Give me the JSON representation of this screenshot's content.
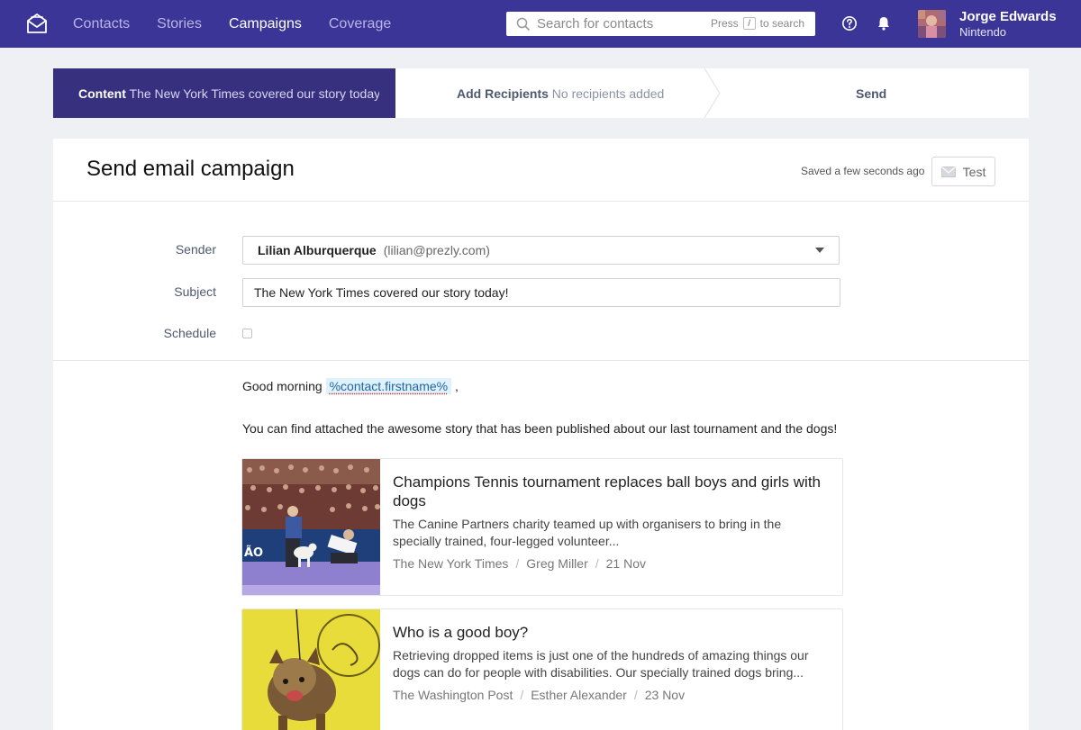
{
  "nav": {
    "links": [
      "Contacts",
      "Stories",
      "Campaigns",
      "Coverage"
    ],
    "active": "Campaigns",
    "search_placeholder": "Search for contacts",
    "search_hint_press": "Press",
    "search_hint_key": "/",
    "search_hint_rest": "to search",
    "user_name": "Jorge Edwards",
    "user_org": "Nintendo"
  },
  "stepper": {
    "step1_label": "Content",
    "step1_detail": "The New York Times covered our story today!",
    "step2_label": "Add Recipients",
    "step2_detail": "No recipients added",
    "step3_label": "Send"
  },
  "campaign": {
    "title": "Send email campaign",
    "saved_status": "Saved a few seconds ago",
    "test_label": "Test",
    "sender_label": "Sender",
    "sender_name": "Lilian Alburquerque",
    "sender_email": "(lilian@prezly.com)",
    "subject_label": "Subject",
    "subject_value": "The New York Times covered our story today!",
    "schedule_label": "Schedule",
    "schedule_checked": false
  },
  "message": {
    "greeting_prefix": "Good morning",
    "placeholder_tag": "%contact.firstname%",
    "greeting_suffix": ",",
    "body": "You can find attached the awesome story that has been published about our last tournament and the dogs!"
  },
  "articles": [
    {
      "title": "Champions Tennis tournament replaces ball boys and girls with dogs",
      "excerpt": "The Canine Partners charity teamed up with organisers to bring in the specially trained, four-legged volunteer...",
      "publication": "The New York Times",
      "author": "Greg Miller",
      "date": "21 Nov"
    },
    {
      "title": "Who is a good boy?",
      "excerpt": "Retrieving dropped items is just one of the hundreds of amazing things our dogs can do for people with disabilities. Our specially trained dogs bring...",
      "publication": "The Washington Post",
      "author": "Esther Alexander",
      "date": "23 Nov"
    }
  ],
  "colors": {
    "nav_bg": "#3a3596",
    "step_active_bg": "#36307e",
    "page_bg": "#eef0f3"
  }
}
